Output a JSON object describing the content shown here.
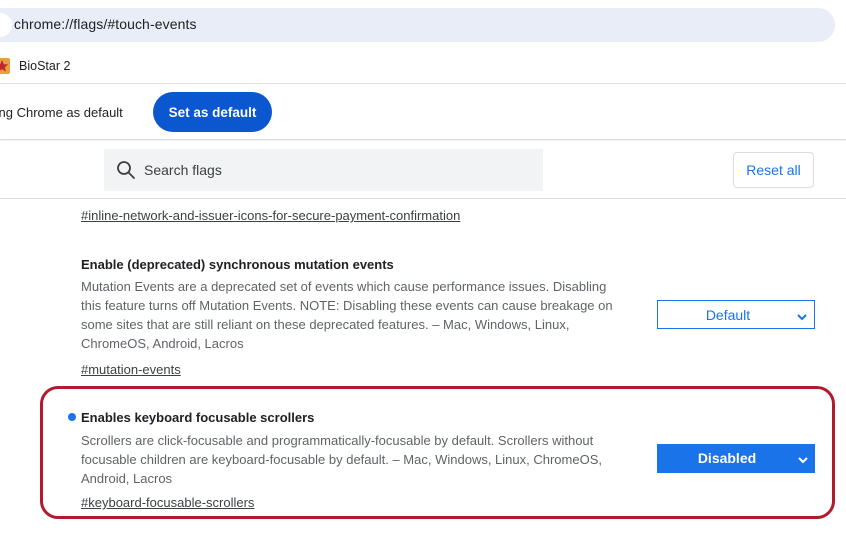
{
  "address_bar": {
    "url": "chrome://flags/#touch-events"
  },
  "bookmarks": [
    {
      "label": "BioStar 2",
      "icon": "biostar-star-icon"
    }
  ],
  "infobar": {
    "text": "ting Chrome as default",
    "button_label": "Set as default"
  },
  "header": {
    "search_placeholder": "Search flags",
    "reset_label": "Reset all"
  },
  "flags": [
    {
      "link": "#inline-network-and-issuer-icons-for-secure-payment-confirmation"
    },
    {
      "title": "Enable (deprecated) synchronous mutation events",
      "description_lines": [
        "Mutation Events are a deprecated set of events which cause performance issues. Disabling",
        "this feature turns off Mutation Events. NOTE: Disabling these events can cause breakage on",
        "some sites that are still reliant on these deprecated features. – Mac, Windows, Linux,",
        "ChromeOS, Android, Lacros"
      ],
      "link": "#mutation-events",
      "value": "Default"
    },
    {
      "title": "Enables keyboard focusable scrollers",
      "description_lines": [
        "Scrollers are click-focusable and programmatically-focusable by default. Scrollers without",
        "focusable children are keyboard-focusable by default. – Mac, Windows, Linux, ChromeOS,",
        "Android, Lacros"
      ],
      "link": "#keyboard-focusable-scrollers",
      "value": "Disabled",
      "modified": true,
      "highlighted": true
    }
  ],
  "colors": {
    "accent": "#1a73e8",
    "button_blue": "#0b57d0",
    "highlight_border": "#b01b2e",
    "address_bar_bg": "#e8edf7"
  }
}
